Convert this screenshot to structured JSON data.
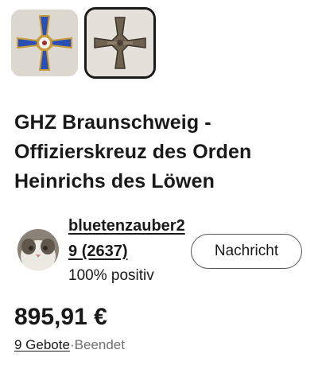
{
  "gallery": {
    "thumbnails": [
      {
        "icon": "blue-cross-order-photo",
        "selected": false
      },
      {
        "icon": "cross-order-reverse-photo",
        "selected": true
      }
    ]
  },
  "listing": {
    "title": "GHZ Braunschweig - Offizierskreuz des Orden Heinrichs des Löwen"
  },
  "seller": {
    "name": "bluetenzauber29",
    "feedback_count": "(2637)",
    "rating": "100% positiv",
    "contact_label": "Nachricht",
    "avatar_icon": "cat-avatar"
  },
  "price": {
    "amount": "895,91 €",
    "bids": "9 Gebote",
    "separator": "·",
    "status": "Beendet"
  },
  "colors": {
    "text": "#191919",
    "secondary_text": "#707070",
    "order_blue": "#2a4fb8"
  }
}
